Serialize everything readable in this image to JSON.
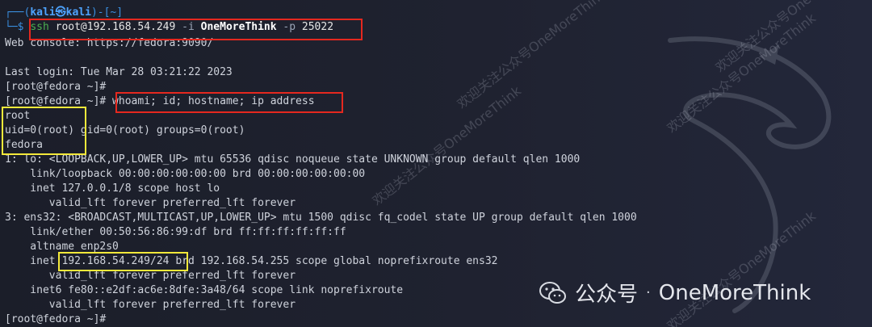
{
  "prompt": {
    "corner": "┌──(",
    "user_host": "kali㉿kali",
    "dir": ")-[~]",
    "arrow": "└─$"
  },
  "lines": [
    "Web console: https://fedora:9090/",
    "",
    "Last login: Tue Mar 28 03:21:22 2023",
    "[root@fedora ~]#",
    "[root@fedora ~]#",
    "root",
    "uid=0(root) gid=0(root) groups=0(root)",
    "fedora",
    "1: lo: <LOOPBACK,UP,LOWER_UP> mtu 65536 qdisc noqueue state UNKNOWN group default qlen 1000",
    "    link/loopback 00:00:00:00:00:00 brd 00:00:00:00:00:00",
    "    inet 127.0.0.1/8 scope host lo",
    "       valid_lft forever preferred_lft forever",
    "3: ens32: <BROADCAST,MULTICAST,UP,LOWER_UP> mtu 1500 qdisc fq_codel state UP group default qlen 1000",
    "    link/ether 00:50:56:86:99:df brd ff:ff:ff:ff:ff:ff",
    "    altname enp2s0",
    "    inet 192.168.54.249/24 brd 192.168.54.255 scope global noprefixroute ens32",
    "       valid_lft forever preferred_lft forever",
    "    inet6 fe80::e2df:ac6e:8dfe:3a48/64 scope link noprefixroute",
    "       valid_lft forever preferred_lft forever",
    "[root@fedora ~]#"
  ],
  "ssh_command": {
    "ssh": "ssh",
    "target": " root@192.168.54.249",
    "flag_i": " -i",
    "key": " OneMoreThink",
    "flag_p": " -p",
    "port": " 25022"
  },
  "whoami_command": " whoami; id; hostname; ip address",
  "brand": {
    "label": "公众号",
    "sep": "·",
    "name": "OneMoreThink"
  },
  "watermark": "欢迎关注公众号OneMoreThink",
  "colors": {
    "highlight_red": "#e5281f",
    "highlight_yellow": "#f4e93a"
  }
}
